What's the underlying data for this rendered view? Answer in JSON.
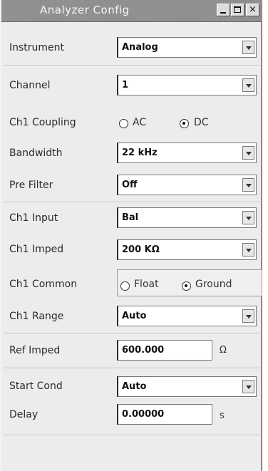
{
  "window": {
    "title": "Analyzer Config",
    "controls": {
      "minimize": "_",
      "maximize": "□",
      "close": "×"
    }
  },
  "fields": {
    "instrument": {
      "label": "Instrument",
      "value": "Analog"
    },
    "channel": {
      "label": "Channel",
      "value": "1"
    },
    "coupling": {
      "label": "Ch1 Coupling",
      "options": [
        "AC",
        "DC"
      ],
      "selected": "DC"
    },
    "bandwidth": {
      "label": "Bandwidth",
      "value": "22 kHz"
    },
    "prefilter": {
      "label": "Pre Filter",
      "value": "Off"
    },
    "input": {
      "label": "Ch1 Input",
      "value": "Bal"
    },
    "imped": {
      "label": "Ch1 Imped",
      "value": "200 KΩ"
    },
    "common": {
      "label": "Ch1 Common",
      "options": [
        "Float",
        "Ground"
      ],
      "selected": "Ground"
    },
    "range": {
      "label": "Ch1 Range",
      "value": "Auto"
    },
    "ref_imped": {
      "label": "Ref Imped",
      "value": "600.000",
      "unit": "Ω"
    },
    "start_cond": {
      "label": "Start Cond",
      "value": "Auto"
    },
    "delay": {
      "label": "Delay",
      "value": "0.00000",
      "unit": "s"
    }
  }
}
